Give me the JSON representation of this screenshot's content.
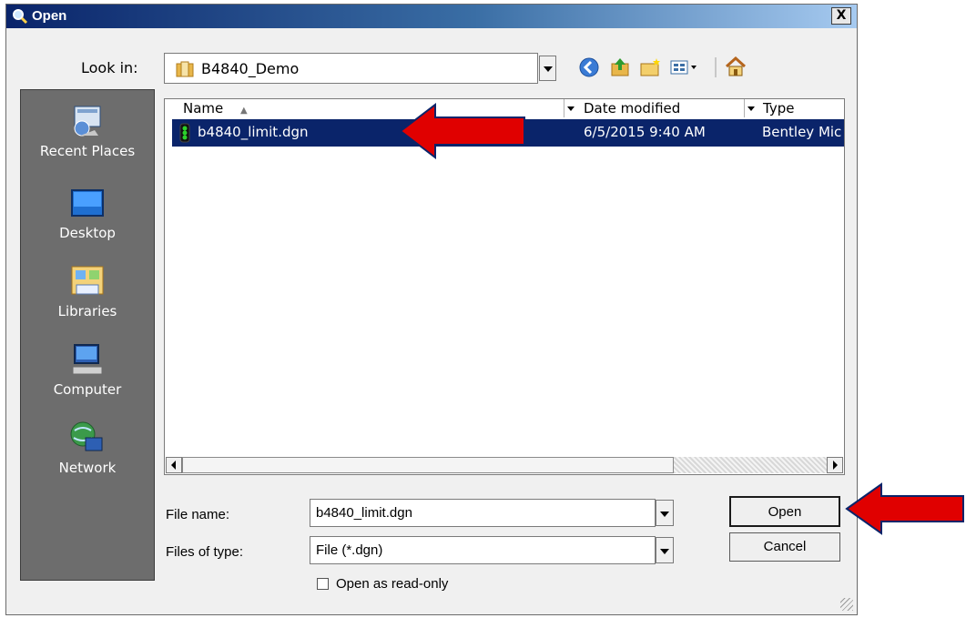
{
  "dialog": {
    "title": "Open",
    "close_label": "X"
  },
  "lookin": {
    "label": "Look in:",
    "value": "B4840_Demo"
  },
  "toolbar": {
    "icons": [
      "back-icon",
      "up-folder-icon",
      "new-folder-icon",
      "view-menu-icon",
      "home-icon"
    ]
  },
  "places": [
    {
      "label": "Recent Places",
      "icon": "recent-places-icon"
    },
    {
      "label": "Desktop",
      "icon": "desktop-icon"
    },
    {
      "label": "Libraries",
      "icon": "libraries-icon"
    },
    {
      "label": "Computer",
      "icon": "computer-icon"
    },
    {
      "label": "Network",
      "icon": "network-icon"
    }
  ],
  "columns": {
    "name": "Name",
    "date": "Date modified",
    "type": "Type"
  },
  "files": [
    {
      "name": "b4840_limit.dgn",
      "date": "6/5/2015 9:40 AM",
      "type": "Bentley Mic",
      "selected": true
    }
  ],
  "filename": {
    "label": "File name:",
    "value": "b4840_limit.dgn"
  },
  "filetype": {
    "label": "Files of type:",
    "value": "File (*.dgn)"
  },
  "readonly": {
    "label": "Open as read-only",
    "checked": false
  },
  "buttons": {
    "open": "Open",
    "cancel": "Cancel"
  },
  "colors": {
    "selection": "#0a246a",
    "places_bg": "#6d6d6d",
    "annotation_arrow": "#e00000"
  }
}
